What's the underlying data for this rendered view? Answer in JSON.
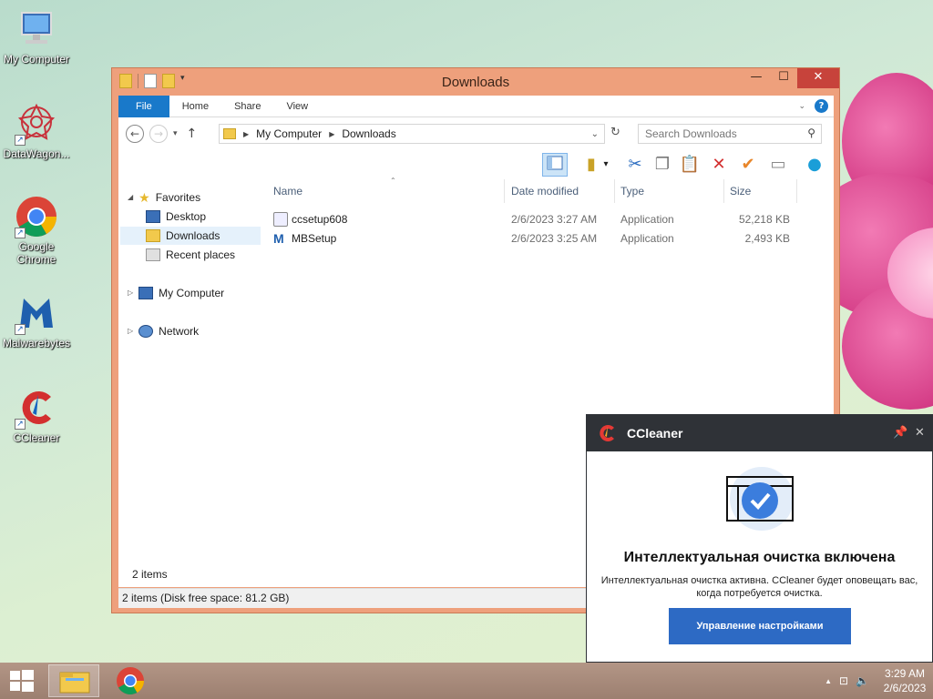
{
  "desktop": {
    "icons": [
      {
        "label": "My Computer"
      },
      {
        "label": "DataWagon..."
      },
      {
        "label": "Google Chrome"
      },
      {
        "label": "Malwarebytes"
      },
      {
        "label": "CCleaner"
      }
    ]
  },
  "explorer": {
    "title": "Downloads",
    "ribbon_tabs": [
      "File",
      "Home",
      "Share",
      "View"
    ],
    "address": {
      "crumbs": [
        "My Computer",
        "Downloads"
      ]
    },
    "search": {
      "placeholder": "Search Downloads"
    },
    "nav_pane": {
      "favorites": "Favorites",
      "desktop": "Desktop",
      "downloads": "Downloads",
      "recent": "Recent places",
      "my_computer": "My Computer",
      "network": "Network"
    },
    "columns": {
      "name": "Name",
      "date": "Date modified",
      "type": "Type",
      "size": "Size"
    },
    "files": [
      {
        "name": "ccsetup608",
        "date": "2/6/2023 3:27 AM",
        "type": "Application",
        "size": "52,218 KB"
      },
      {
        "name": "MBSetup",
        "date": "2/6/2023 3:25 AM",
        "type": "Application",
        "size": "2,493 KB"
      }
    ],
    "item_count": "2 items",
    "status": "2 items (Disk free space: 81.2 GB)"
  },
  "ccleaner": {
    "app_name": "CCleaner",
    "heading": "Интеллектуальная очистка включена",
    "body": "Интеллектуальная очистка активна. CCleaner будет оповещать вас, когда потребуется очистка.",
    "button": "Управление настройками"
  },
  "taskbar": {
    "time": "3:29 AM",
    "date": "2/6/2023"
  },
  "colors": {
    "window_frame": "#eea07c",
    "ribbon_file": "#1979ca",
    "cc_button": "#2d6ac4",
    "cc_header": "#2f3237"
  }
}
